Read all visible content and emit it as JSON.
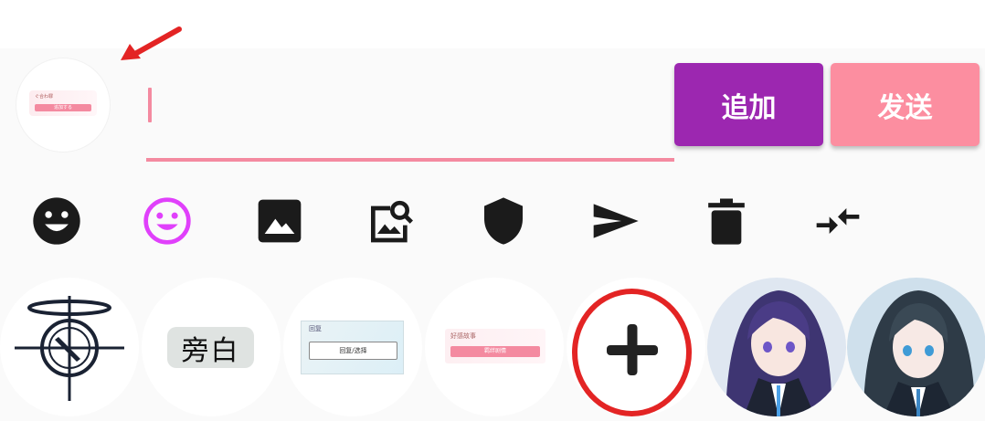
{
  "input": {
    "value": "",
    "placeholder": ""
  },
  "buttons": {
    "add_label": "追加",
    "send_label": "发送"
  },
  "selected_avatar": {
    "card_title": "ぐ合わ罪",
    "card_button": "追加する"
  },
  "toolbar": [
    {
      "icon": "emoji-icon-black"
    },
    {
      "icon": "emoji-icon-purple"
    },
    {
      "icon": "image-icon"
    },
    {
      "icon": "image-search-icon"
    },
    {
      "icon": "shield-icon"
    },
    {
      "icon": "send-icon"
    },
    {
      "icon": "delete-icon"
    },
    {
      "icon": "compress-icon"
    }
  ],
  "avatars": {
    "narration_label": "旁白",
    "card2_header": "回复",
    "card2_button": "回复/选择",
    "card3_header": "好感故事",
    "card3_button": "羁绊剧情"
  },
  "colors": {
    "accent_pink": "#fc8ea0",
    "accent_purple": "#9c27b0",
    "annotation_red": "#e32424",
    "emoji_purple": "#e040fb"
  }
}
